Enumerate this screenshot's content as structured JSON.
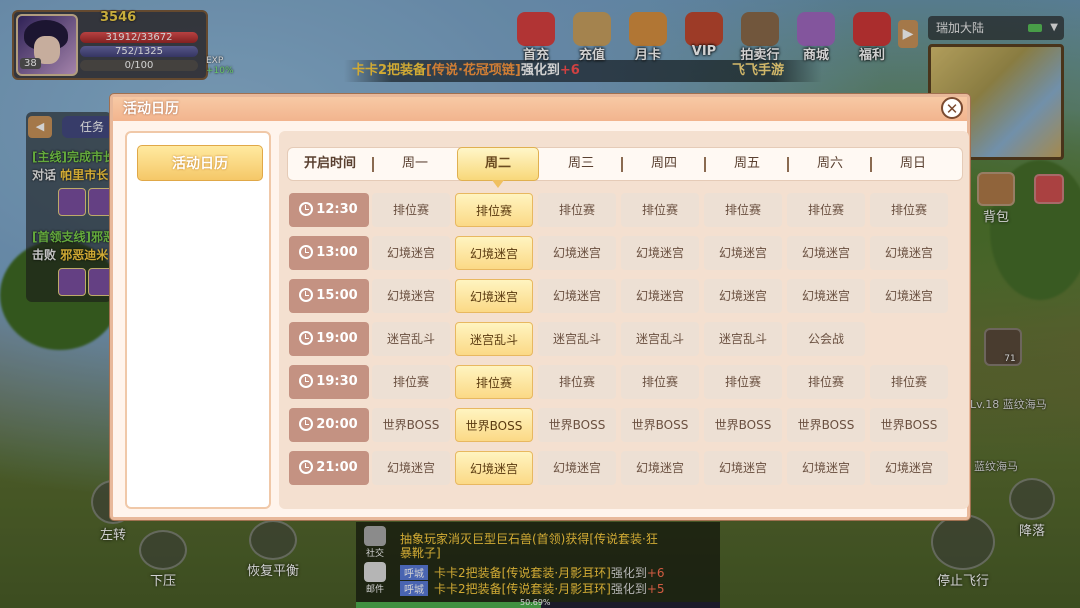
{
  "player": {
    "gold": "3546",
    "level": "38",
    "hp": "31912/33672",
    "mp": "752/1325",
    "xp": "0/100",
    "exp_label": "EXP",
    "exp_bonus": "+10%"
  },
  "top_icons": [
    {
      "label": "首充",
      "icon": "gift-icon",
      "color": "#d84040"
    },
    {
      "label": "充值",
      "icon": "coin-icon",
      "color": "#c8a060"
    },
    {
      "label": "月卡",
      "icon": "card-icon",
      "color": "#d89040"
    },
    {
      "label": "VIP",
      "icon": "crown-icon",
      "color": "#c04830"
    },
    {
      "label": "拍卖行",
      "icon": "scale-icon",
      "color": "#8a6a4a"
    },
    {
      "label": "商城",
      "icon": "shop-icon",
      "color": "#a068c0"
    },
    {
      "label": "福利",
      "icon": "welfare-icon",
      "color": "#d03838"
    }
  ],
  "map_selector": "瑞加大陆",
  "announcement": {
    "prefix": "卡卡2把装备",
    "item": "[传说·花冠项链]",
    "mid": "强化到",
    "level": "+6",
    "right": "飞飞手游"
  },
  "quest": {
    "tab_label": "任务",
    "main_tag": "[主线]完成市长",
    "main_action": "对话",
    "main_target": "帕里市长",
    "branch_tag": "[首领支线]邪恶",
    "branch_action": "击败",
    "branch_target": "邪恶迪米"
  },
  "bottom": {
    "turn_left": "左转",
    "turn_right": "右转",
    "down": "下压",
    "balance": "恢复平衡",
    "stop_fly": "停止飞行",
    "land": "降落"
  },
  "chat": {
    "social_label": "社交",
    "mail_label": "邮件",
    "line1": "抽象玩家消灭巨型巨石兽(首领)获得[传说套装·狂",
    "line1b": "暴靴子]",
    "tag": "呼城",
    "line2_prefix": "卡卡2把装备",
    "line2_item": "[传说套装·月影耳环]",
    "line2_mid": "强化到",
    "line2_lvl": "+6",
    "line3_prefix": "卡卡2把装备",
    "line3_item": "[传说套装·月影耳环]",
    "line3_mid": "强化到",
    "line3_lvl": "+5",
    "exp_percent": "50.69%",
    "exp_value": 0.5069
  },
  "side": {
    "bag_label": "背包",
    "npc_level": "Lv.18",
    "npc_name": "蓝纹海马",
    "npc_name2": "蓝纹海马",
    "count": "71"
  },
  "modal": {
    "title": "活动日历",
    "category": "活动日历",
    "header": [
      "开启时间",
      "周一",
      "周二",
      "周三",
      "周四",
      "周五",
      "周六",
      "周日"
    ],
    "selected_day_index": 1,
    "rows": [
      {
        "time": "12:30",
        "cells": [
          "排位赛",
          "排位赛",
          "排位赛",
          "排位赛",
          "排位赛",
          "排位赛",
          "排位赛"
        ]
      },
      {
        "time": "13:00",
        "cells": [
          "幻境迷宫",
          "幻境迷宫",
          "幻境迷宫",
          "幻境迷宫",
          "幻境迷宫",
          "幻境迷宫",
          "幻境迷宫"
        ]
      },
      {
        "time": "15:00",
        "cells": [
          "幻境迷宫",
          "幻境迷宫",
          "幻境迷宫",
          "幻境迷宫",
          "幻境迷宫",
          "幻境迷宫",
          "幻境迷宫"
        ]
      },
      {
        "time": "19:00",
        "cells": [
          "迷宫乱斗",
          "迷宫乱斗",
          "迷宫乱斗",
          "迷宫乱斗",
          "迷宫乱斗",
          "公会战",
          ""
        ]
      },
      {
        "time": "19:30",
        "cells": [
          "排位赛",
          "排位赛",
          "排位赛",
          "排位赛",
          "排位赛",
          "排位赛",
          "排位赛"
        ]
      },
      {
        "time": "20:00",
        "cells": [
          "世界BOSS",
          "世界BOSS",
          "世界BOSS",
          "世界BOSS",
          "世界BOSS",
          "世界BOSS",
          "世界BOSS"
        ]
      },
      {
        "time": "21:00",
        "cells": [
          "幻境迷宫",
          "幻境迷宫",
          "幻境迷宫",
          "幻境迷宫",
          "幻境迷宫",
          "幻境迷宫",
          "幻境迷宫"
        ]
      }
    ],
    "close_icon": "close-icon"
  }
}
